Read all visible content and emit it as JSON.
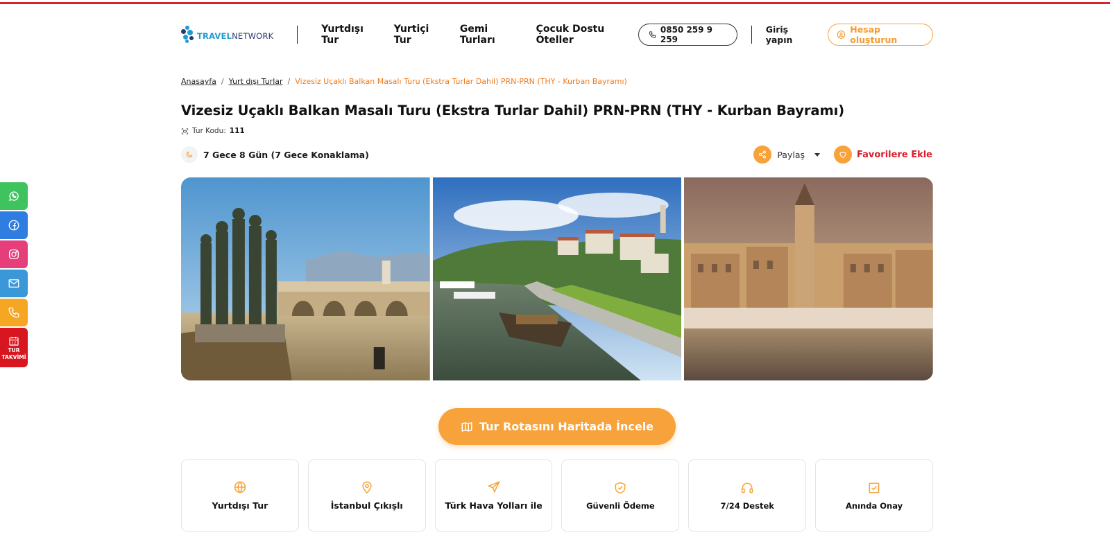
{
  "brand": {
    "logo_part1": "TRAVEL",
    "logo_part2": "NETWORK"
  },
  "nav": [
    {
      "label": "Yurtdışı Tur"
    },
    {
      "label": "Yurtiçi Tur"
    },
    {
      "label": "Gemi Turları"
    },
    {
      "label": "Çocuk Dostu Oteller"
    }
  ],
  "header": {
    "phone": "0850 259 9 259",
    "login_label": "Giriş yapın",
    "signup_label": "Hesap oluşturun"
  },
  "breadcrumb": {
    "home": "Anasayfa",
    "category": "Yurt dışı Turlar",
    "current": "Vizesiz Uçaklı Balkan Masalı Turu (Ekstra Turlar Dahil) PRN-PRN (THY - Kurban Bayramı)"
  },
  "tour": {
    "title": "Vizesiz Uçaklı Balkan Masalı Turu (Ekstra Turlar Dahil) PRN-PRN (THY - Kurban Bayramı)",
    "code_label": "Tur Kodu:",
    "code": "111",
    "duration": "7 Gece 8 Gün (7 Gece Konaklama)"
  },
  "actions": {
    "share_label": "Paylaş",
    "favorite_label": "Favorilere Ekle"
  },
  "route_button": {
    "label": "Tur Rotasını Haritada İncele"
  },
  "features": [
    {
      "label": "Yurtdışı Tur",
      "icon": "globe-icon"
    },
    {
      "label": "İstanbul Çıkışlı",
      "icon": "location-pin-icon"
    },
    {
      "label": "Türk Hava Yolları ile",
      "icon": "plane-icon"
    },
    {
      "label": "Güvenli Ödeme",
      "icon": "shield-check-icon"
    },
    {
      "label": "7/24 Destek",
      "icon": "headset-icon"
    },
    {
      "label": "Anında Onay",
      "icon": "checkbox-icon"
    }
  ],
  "social": {
    "whatsapp_color": "#3fc35f",
    "facebook_color": "#2f7de1",
    "instagram_color": "#e63e7a",
    "mail_color": "#3a97d8",
    "phone_color": "#f5a623",
    "calendar_color": "#d8161f",
    "calendar_day": "12",
    "calendar_label_1": "TUR",
    "calendar_label_2": "TAKVİMİ"
  },
  "colors": {
    "accent": "#f7a23b",
    "brand_red": "#d8232a",
    "breadcrumb_active": "#f07a1d"
  }
}
